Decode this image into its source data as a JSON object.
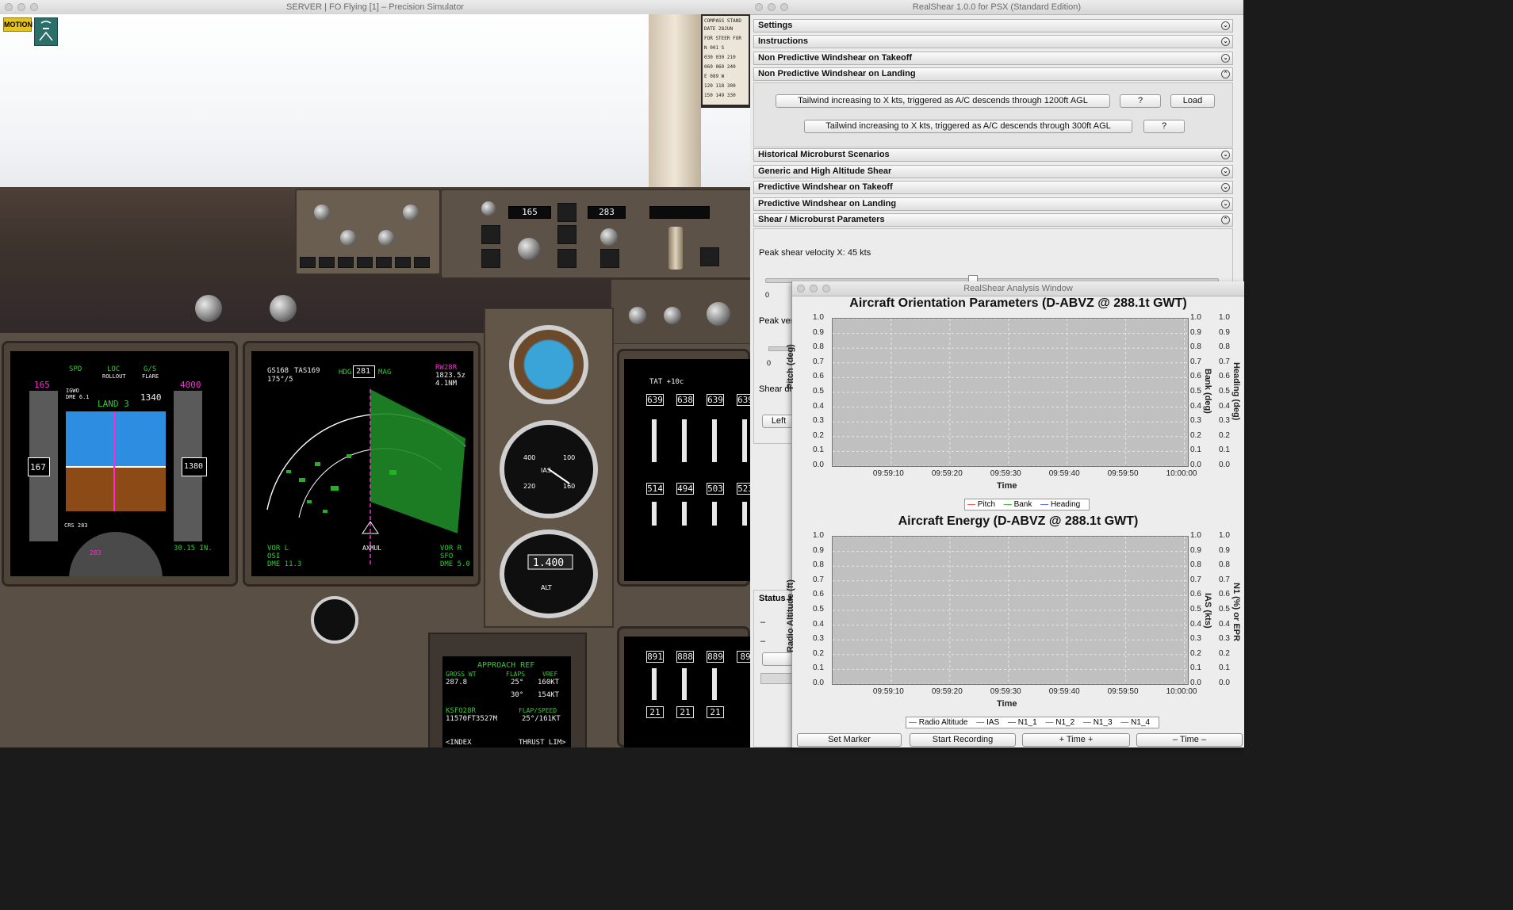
{
  "sim": {
    "title": "SERVER | FO Flying [1] – Precision Simulator",
    "motion_badge": "MOTION",
    "mcp": {
      "ias": "165",
      "hdg": "283"
    },
    "pfd": {
      "speed_bug": "165",
      "alt_bug": "4000",
      "mode_spd": "SPD",
      "mode_loc": "LOC",
      "mode_rollout": "ROLLOUT",
      "mode_gs": "G/S",
      "mode_flare": "FLARE",
      "ils": "IGWO",
      "dme": "DME 6.1",
      "land": "LAND 3",
      "radio": "1340",
      "speed": "167",
      "alt": "1380",
      "baro": "30.15 IN.",
      "crs": "CRS 283",
      "hdg_readout": "283"
    },
    "nd": {
      "gs": "GS168",
      "tas": "TAS169",
      "wind": "175°/5",
      "hdg": "281",
      "mag": "MAG",
      "hdg_label": "HDG",
      "wpt": "RW28R",
      "time": "1823.5z",
      "dist": "4.1NM",
      "vor_l": "VOR L",
      "osi": "OSI",
      "dme_l": "DME 11.3",
      "vor_r": "VOR R",
      "sfo": "SFO",
      "dme_r": "DME 5.0",
      "fix": "AXMUL"
    },
    "eicas": {
      "tat": "TAT +10c",
      "epr": [
        "639",
        "638",
        "639",
        "639"
      ],
      "egt": [
        "514",
        "494",
        "503",
        "523"
      ],
      "n2": [
        "891",
        "888",
        "889",
        "89"
      ],
      "ff": [
        "21",
        "21",
        "21"
      ]
    },
    "cdu": {
      "title": "APPROACH REF",
      "gross_wt": "GROSS WT",
      "flaps": "FLAPS",
      "vref": "VREF",
      "wt_val": "287.8",
      "f25": "25°",
      "v25": "160KT",
      "f30": "30°",
      "v30": "154KT",
      "rwy": "KSFO28R",
      "flap_speed": "FLAP/SPEED",
      "rwy_len": "11570FT3527M",
      "fs_val": "25°/161KT",
      "index": "<INDEX",
      "thrust_lim": "THRUST LIM>"
    }
  },
  "realshear": {
    "title": "RealShear 1.0.0 for PSX (Standard Edition)",
    "sections": [
      {
        "label": "Settings"
      },
      {
        "label": "Instructions"
      },
      {
        "label": "Non Predictive Windshear on Takeoff"
      },
      {
        "label": "Non Predictive Windshear on Landing"
      },
      {
        "label": "Historical Microburst Scenarios"
      },
      {
        "label": "Generic and High Altitude Shear"
      },
      {
        "label": "Predictive Windshear on Takeoff"
      },
      {
        "label": "Predictive Windshear on Landing"
      },
      {
        "label": "Shear / Microburst Parameters"
      }
    ],
    "landing": {
      "scenario1": "Tailwind increasing to X kts, triggered as A/C descends through 1200ft AGL",
      "scenario2": "Tailwind increasing to X kts, triggered as A/C descends through 300ft AGL",
      "help": "?",
      "load": "Load"
    },
    "params": {
      "peak_shear": "Peak shear velocity X: 45 kts",
      "peak_partial": "Peak ver",
      "shear_dir": "Shear di",
      "left": "Left",
      "zero": "0",
      "status": "Status a",
      "dash": "–"
    }
  },
  "analysis": {
    "title": "RealShear Analysis Window",
    "chart1": {
      "title": "Aircraft Orientation Parameters (D-ABVZ @ 288.1t GWT)",
      "ylabel": "Pitch (deg)",
      "y2label": "Bank (deg)",
      "y3label": "Heading (deg)",
      "xlabel": "Time",
      "legend": [
        "Pitch",
        "Bank",
        "Heading"
      ]
    },
    "chart2": {
      "title": "Aircraft Energy (D-ABVZ @ 288.1t GWT)",
      "ylabel": "Radio Altitude (ft)",
      "y2label": "IAS (kts)",
      "y3label": "N1 (%) or EPR",
      "xlabel": "Time",
      "legend": [
        "Radio Altitude",
        "IAS",
        "N1_1",
        "N1_2",
        "N1_3",
        "N1_4"
      ]
    },
    "buttons": {
      "marker": "Set Marker",
      "record": "Start Recording",
      "time_plus": "+ Time +",
      "time_minus": "– Time –"
    }
  },
  "chart_data": [
    {
      "type": "line",
      "title": "Aircraft Orientation Parameters (D-ABVZ @ 288.1t GWT)",
      "xlabel": "Time",
      "ylabel": "Pitch (deg)",
      "x_ticks": [
        "09:59:10",
        "09:59:20",
        "09:59:30",
        "09:59:40",
        "09:59:50",
        "10:00:00"
      ],
      "y_ticks": [
        "0.0",
        "0.1",
        "0.2",
        "0.3",
        "0.4",
        "0.5",
        "0.6",
        "0.7",
        "0.8",
        "0.9",
        "1.0"
      ],
      "ylim": [
        0.0,
        1.0
      ],
      "series": [
        {
          "name": "Pitch",
          "values": [],
          "color": "#ff5a5a"
        },
        {
          "name": "Bank",
          "values": [],
          "color": "#35c535"
        },
        {
          "name": "Heading",
          "values": [],
          "color": "#5a6cff"
        }
      ],
      "grid": true,
      "legend": "bottom"
    },
    {
      "type": "line",
      "title": "Aircraft Energy (D-ABVZ @ 288.1t GWT)",
      "xlabel": "Time",
      "ylabel": "Radio Altitude (ft)",
      "x_ticks": [
        "09:59:10",
        "09:59:20",
        "09:59:30",
        "09:59:40",
        "09:59:50",
        "10:00:00"
      ],
      "y_ticks": [
        "0.0",
        "0.1",
        "0.2",
        "0.3",
        "0.4",
        "0.5",
        "0.6",
        "0.7",
        "0.8",
        "0.9",
        "1.0"
      ],
      "ylim": [
        0.0,
        1.0
      ],
      "series": [
        {
          "name": "Radio Altitude",
          "values": [],
          "color": "#ff5a5a"
        },
        {
          "name": "IAS",
          "values": [],
          "color": "#35c535"
        },
        {
          "name": "N1_1",
          "values": [],
          "color": "#5a6cff"
        },
        {
          "name": "N1_2",
          "values": [],
          "color": "#ff5a5a"
        },
        {
          "name": "N1_3",
          "values": [],
          "color": "#ff5a5a"
        },
        {
          "name": "N1_4",
          "values": [],
          "color": "#ff5a5a"
        }
      ],
      "grid": true,
      "legend": "bottom"
    }
  ]
}
